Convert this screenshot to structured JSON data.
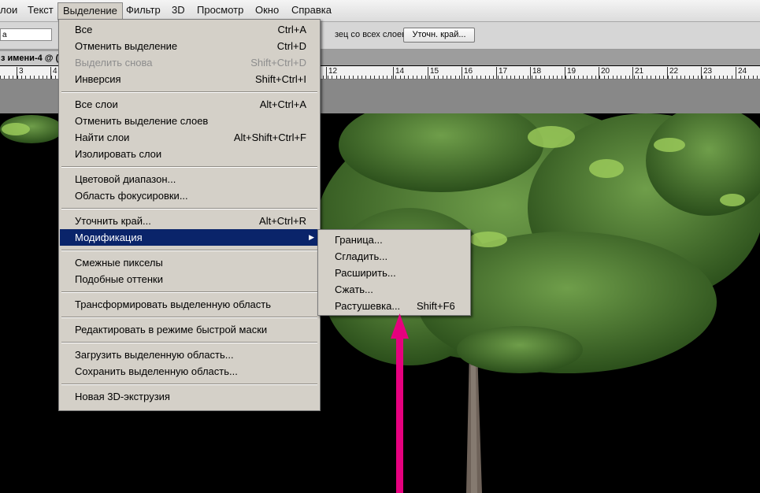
{
  "menubar": {
    "items": [
      "лои",
      "Текст",
      "Выделение",
      "Фильтр",
      "3D",
      "Просмотр",
      "Окно",
      "Справка"
    ],
    "active_index": 2
  },
  "options_bar": {
    "tool_combo": "а",
    "sample_all_layers_label": "зец со всех слоев",
    "refine_edge_button": "Уточн. край..."
  },
  "document_tab": {
    "title": "з имени-4 @ ("
  },
  "ruler": {
    "labels": [
      "3",
      "4",
      "12",
      "14",
      "15",
      "16",
      "17",
      "18",
      "19",
      "20",
      "21",
      "22",
      "23",
      "24"
    ]
  },
  "select_menu": {
    "groups": [
      [
        {
          "label": "Все",
          "shortcut": "Ctrl+A",
          "enabled": true
        },
        {
          "label": "Отменить выделение",
          "shortcut": "Ctrl+D",
          "enabled": true
        },
        {
          "label": "Выделить снова",
          "shortcut": "Shift+Ctrl+D",
          "enabled": false
        },
        {
          "label": "Инверсия",
          "shortcut": "Shift+Ctrl+I",
          "enabled": true
        }
      ],
      [
        {
          "label": "Все слои",
          "shortcut": "Alt+Ctrl+A",
          "enabled": true
        },
        {
          "label": "Отменить выделение слоев",
          "shortcut": "",
          "enabled": true
        },
        {
          "label": "Найти слои",
          "shortcut": "Alt+Shift+Ctrl+F",
          "enabled": true
        },
        {
          "label": "Изолировать слои",
          "shortcut": "",
          "enabled": true
        }
      ],
      [
        {
          "label": "Цветовой диапазон...",
          "shortcut": "",
          "enabled": true
        },
        {
          "label": "Область фокусировки...",
          "shortcut": "",
          "enabled": true
        }
      ],
      [
        {
          "label": "Уточнить край...",
          "shortcut": "Alt+Ctrl+R",
          "enabled": true
        },
        {
          "label": "Модификация",
          "shortcut": "",
          "enabled": true,
          "highlighted": true,
          "submenu": true
        }
      ],
      [
        {
          "label": "Смежные пикселы",
          "shortcut": "",
          "enabled": true
        },
        {
          "label": "Подобные оттенки",
          "shortcut": "",
          "enabled": true
        }
      ],
      [
        {
          "label": "Трансформировать выделенную область",
          "shortcut": "",
          "enabled": true
        }
      ],
      [
        {
          "label": "Редактировать в режиме быстрой маски",
          "shortcut": "",
          "enabled": true
        }
      ],
      [
        {
          "label": "Загрузить выделенную область...",
          "shortcut": "",
          "enabled": true
        },
        {
          "label": "Сохранить выделенную область...",
          "shortcut": "",
          "enabled": true
        }
      ],
      [
        {
          "label": "Новая 3D-экструзия",
          "shortcut": "",
          "enabled": true
        }
      ]
    ]
  },
  "modify_submenu": {
    "items": [
      {
        "label": "Граница...",
        "shortcut": ""
      },
      {
        "label": "Сгладить...",
        "shortcut": ""
      },
      {
        "label": "Расширить...",
        "shortcut": ""
      },
      {
        "label": "Сжать...",
        "shortcut": ""
      },
      {
        "label": "Растушевка...",
        "shortcut": "Shift+F6"
      }
    ]
  },
  "colors": {
    "menu_bg": "#d4d0c8",
    "highlight": "#0a246a",
    "annotation_arrow": "#e6007e",
    "canvas_bg": "#000000",
    "foliage": "#3f6e2a"
  },
  "icons": {
    "submenu_arrow": "chevron-right-icon",
    "annotation": "up-arrow-icon"
  }
}
